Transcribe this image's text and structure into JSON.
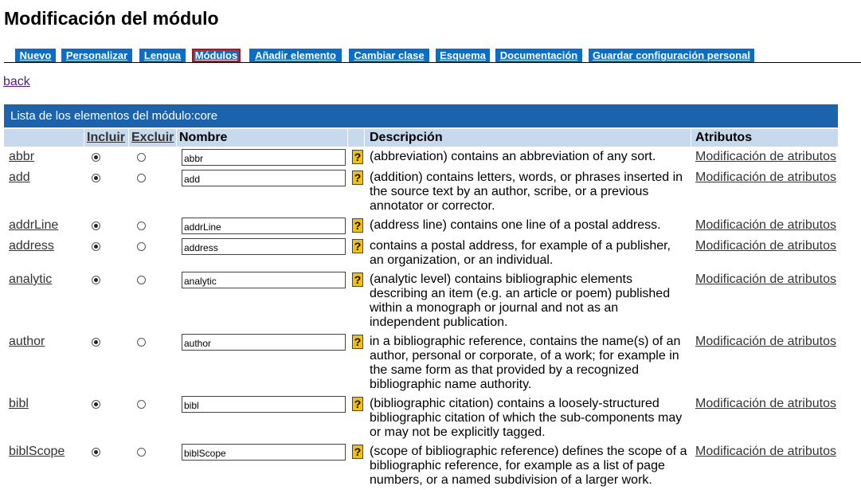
{
  "page_title": "Modificación del módulo",
  "tabs": [
    {
      "label": "Nuevo",
      "active": false
    },
    {
      "label": "Personalizar",
      "active": false
    },
    {
      "label": "Lengua",
      "active": false
    },
    {
      "label": "Módulos",
      "active": true
    },
    {
      "label": "Añadir elemento",
      "active": false
    },
    {
      "label": "Cambiar clase",
      "active": false
    },
    {
      "label": "Esquema",
      "active": false
    },
    {
      "label": "Documentación",
      "active": false
    },
    {
      "label": "Guardar configuración personal",
      "active": false
    }
  ],
  "back_label": "back",
  "panel_title": "Lista de los elementos del módulo:core",
  "columns": {
    "include": "Incluir",
    "exclude": "Excluir",
    "name": "Nombre",
    "description": "Descripción",
    "attributes": "Atributos"
  },
  "help_glyph": "?",
  "attr_link_label": "Modificación de atributos",
  "rows": [
    {
      "name": "abbr",
      "included": true,
      "input_value": "abbr",
      "description": [
        "(abbreviation) contains an abbreviation of any sort."
      ]
    },
    {
      "name": "add",
      "included": true,
      "input_value": "add",
      "description": [
        "(addition) contains letters, words, or phrases inserted in",
        "the source text by an author, scribe, or a previous",
        "annotator or corrector."
      ]
    },
    {
      "name": "addrLine",
      "included": true,
      "input_value": "addrLine",
      "description": [
        "(address line) contains one line of a postal address."
      ]
    },
    {
      "name": "address",
      "included": true,
      "input_value": "address",
      "description": [
        "contains a postal address, for example of a publisher,",
        "an organization, or an individual."
      ]
    },
    {
      "name": "analytic",
      "included": true,
      "input_value": "analytic",
      "description": [
        "(analytic level) contains bibliographic elements",
        "describing an item (e.g. an article or poem) published",
        "within a monograph or journal and not as an",
        "independent publication."
      ]
    },
    {
      "name": "author",
      "included": true,
      "input_value": "author",
      "description": [
        "in a bibliographic reference, contains the name(s) of an",
        "author, personal or corporate, of a work; for example in",
        "the same form as that provided by a recognized",
        "bibliographic name authority."
      ]
    },
    {
      "name": "bibl",
      "included": true,
      "input_value": "bibl",
      "description": [
        "(bibliographic citation) contains a loosely-structured",
        "bibliographic citation of which the sub-components may",
        "or may not be explicitly tagged."
      ]
    },
    {
      "name": "biblScope",
      "included": true,
      "input_value": "biblScope",
      "description": [
        "(scope of bibliographic reference) defines the scope of a",
        "bibliographic reference, for example as a list of page",
        "numbers, or a named subdivision of a larger work."
      ]
    }
  ]
}
